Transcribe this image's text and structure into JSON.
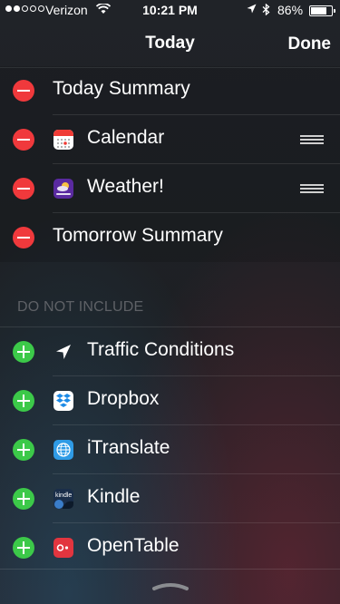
{
  "status_bar": {
    "carrier": "Verizon",
    "time": "10:21 PM",
    "battery_percent": "86%",
    "battery_level": 0.86,
    "signal_bars_filled": 2,
    "signal_bars_total": 5
  },
  "nav": {
    "title": "Today",
    "done_label": "Done"
  },
  "included": [
    {
      "label": "Today Summary",
      "icon": null
    },
    {
      "label": "Calendar",
      "icon": "calendar-icon",
      "reorderable": true
    },
    {
      "label": "Weather!",
      "icon": "yahoo-weather-icon",
      "reorderable": true
    },
    {
      "label": "Tomorrow Summary",
      "icon": null
    }
  ],
  "excluded_header": "DO NOT INCLUDE",
  "excluded": [
    {
      "label": "Traffic Conditions",
      "icon": "location-arrow-icon"
    },
    {
      "label": "Dropbox",
      "icon": "dropbox-icon"
    },
    {
      "label": "iTranslate",
      "icon": "globe-icon"
    },
    {
      "label": "Kindle",
      "icon": "kindle-icon",
      "icon_text": "kindle"
    },
    {
      "label": "OpenTable",
      "icon": "opentable-icon"
    }
  ],
  "colors": {
    "remove": "#f0393c",
    "add": "#3cc949",
    "background": "#1b1e23"
  }
}
